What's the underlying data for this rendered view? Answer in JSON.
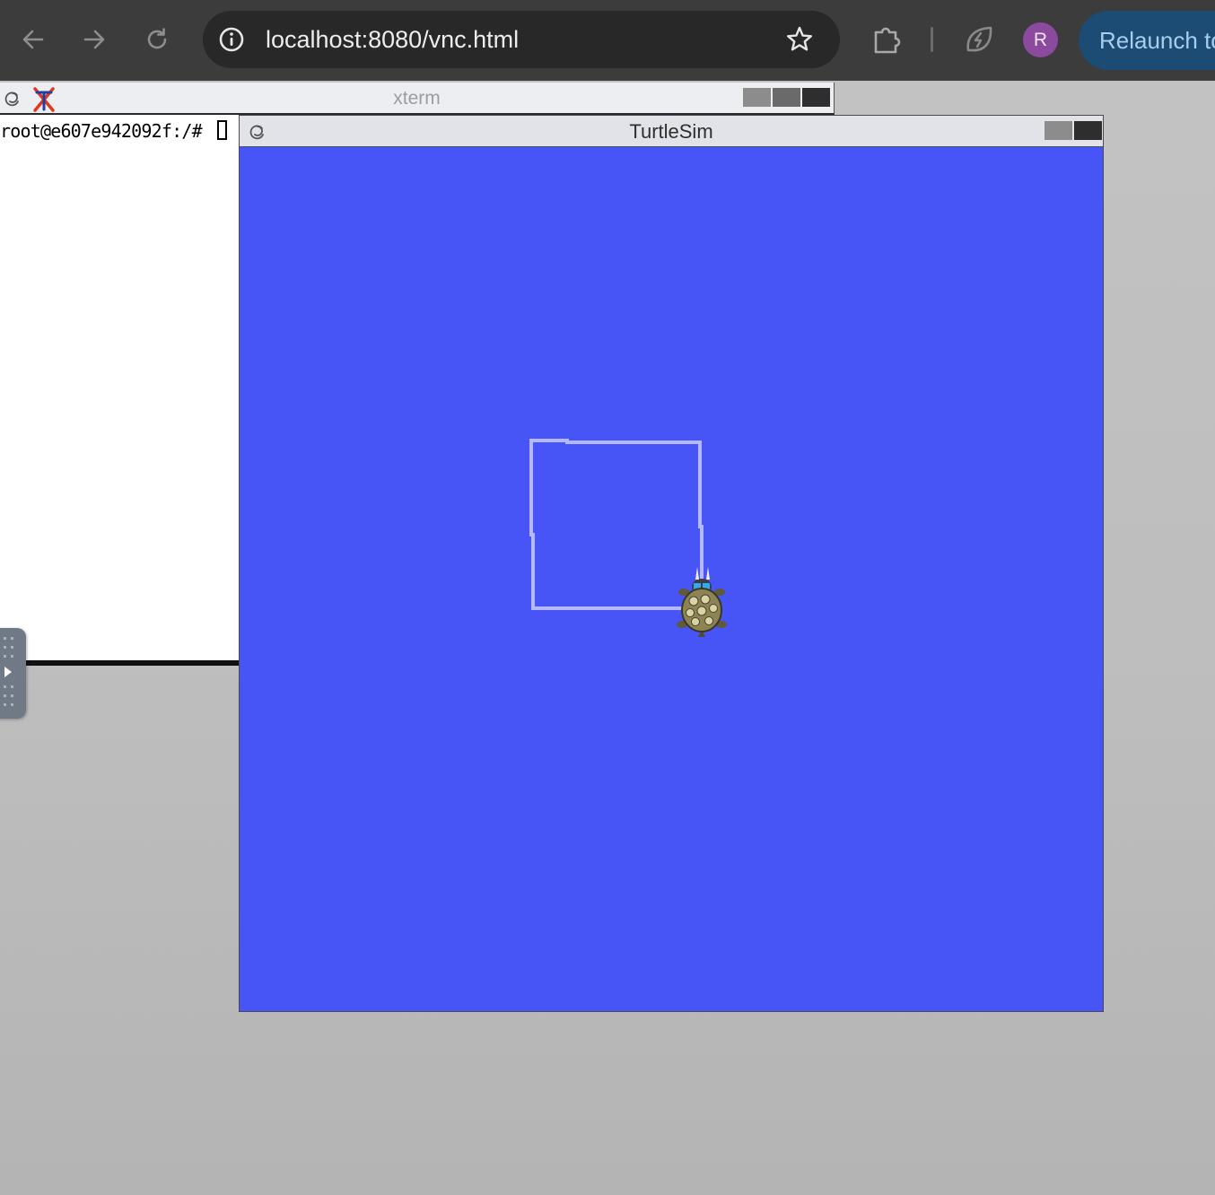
{
  "browser": {
    "url": "localhost:8080/vnc.html",
    "profile_initial": "R",
    "relaunch_label": "Relaunch to update",
    "icons": {
      "back": "arrow-left-icon",
      "forward": "arrow-right-icon",
      "reload": "reload-icon",
      "site_info": "info-icon",
      "bookmark": "star-icon",
      "extensions": "puzzle-icon",
      "performance": "leaf-bolt-icon"
    },
    "colors": {
      "toolbar": "#3c3c3c",
      "omnibox": "#282828",
      "avatar": "#8b4a9e",
      "relaunch_button": "#1c4b74"
    }
  },
  "xterm": {
    "title": "xterm",
    "prompt": "root@e607e942092f:/# "
  },
  "turtlesim": {
    "title": "TurtleSim",
    "background_color": "#4755f6",
    "pen_color": "#b3b8ff"
  }
}
